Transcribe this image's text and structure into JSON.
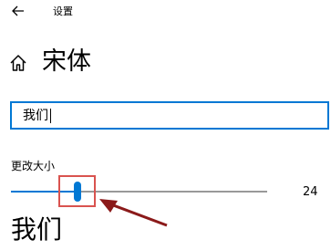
{
  "header": {
    "back_icon": "back-arrow-icon",
    "title": "设置"
  },
  "page": {
    "home_icon": "home-icon",
    "title": "宋体"
  },
  "preview_input": {
    "value": "我们"
  },
  "size_control": {
    "label": "更改大小",
    "value": "24",
    "level_fraction": 0.26
  },
  "preview": {
    "text": "我们"
  },
  "annotation": {
    "highlight_color": "#d9534f",
    "arrow_color": "#8b1a1a"
  },
  "colors": {
    "accent": "#0078d4",
    "track_rest": "#999999"
  }
}
